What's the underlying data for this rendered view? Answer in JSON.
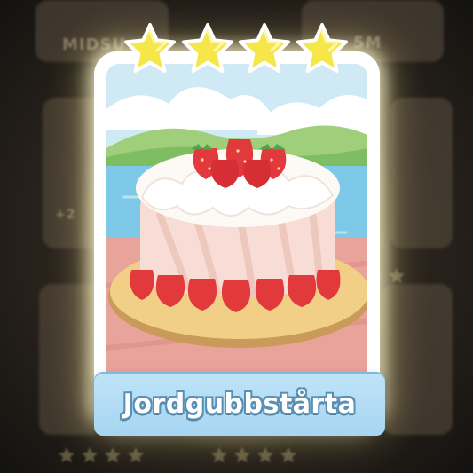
{
  "card": {
    "title": "Jordgubbstårta",
    "star_rating": 4,
    "art_subject": "strawberry-cream-cake-icon",
    "accent_colors": {
      "glow": "#fff6c8",
      "banner": "#a7d5f1",
      "banner_outline": "#5a8fb3",
      "star_fill": "#f5e74a"
    }
  },
  "background": {
    "left_card_label": "MIDSU",
    "right_card_label": "5M",
    "left_card_badge": "+2"
  }
}
